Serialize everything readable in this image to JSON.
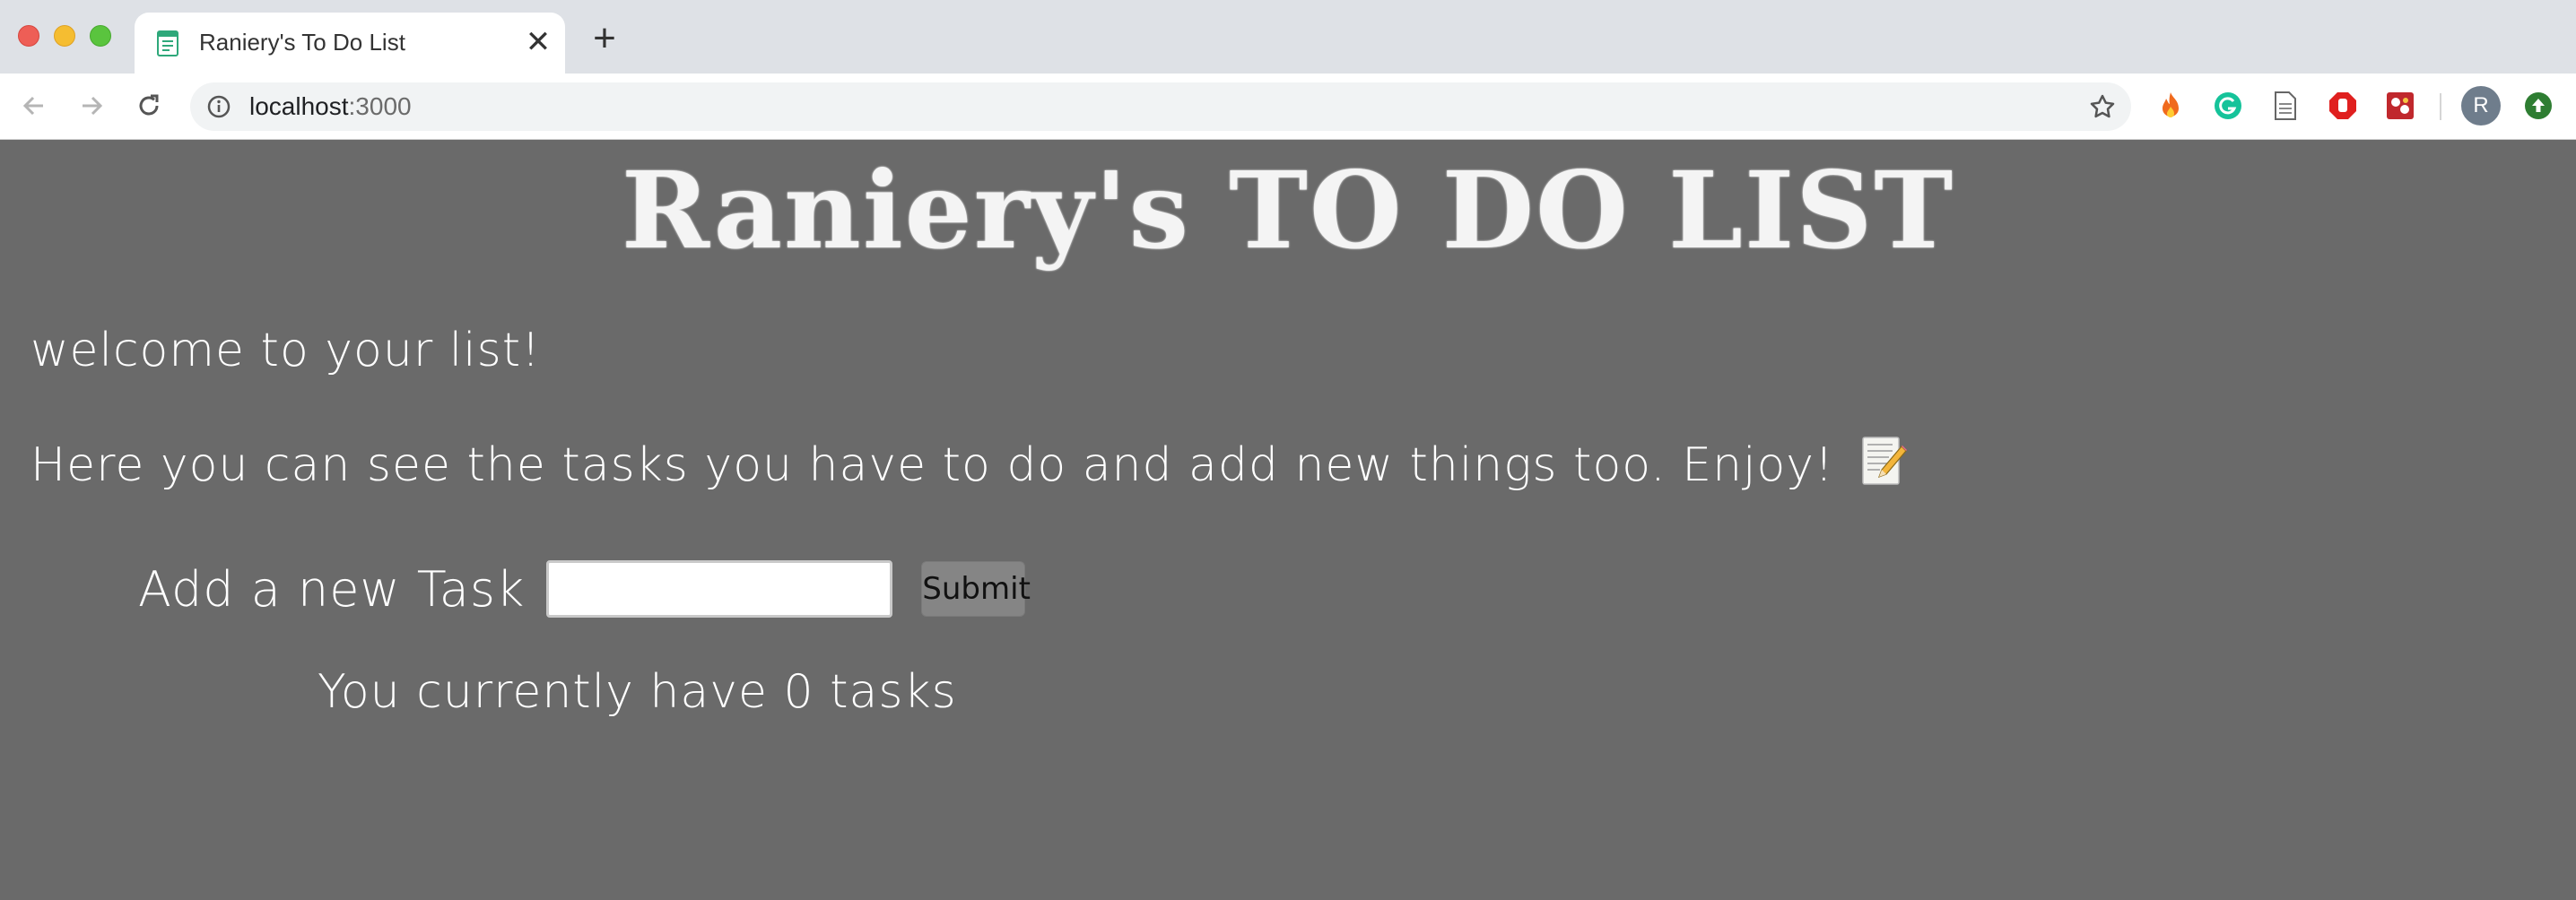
{
  "browser": {
    "tab": {
      "title": "Raniery's To Do List",
      "favicon": "notepad-icon",
      "close_glyph": "✕"
    },
    "new_tab_glyph": "+",
    "address": {
      "host": "localhost",
      "port": ":3000"
    },
    "avatar_initial": "R",
    "extensions": [
      "fire-icon",
      "grammarly-icon",
      "document-icon",
      "adblock-icon",
      "puzzle-icon",
      "update-icon"
    ]
  },
  "page": {
    "title": "Raniery's TO DO LIST",
    "welcome": "welcome to your list!",
    "intro": "Here you can see the tasks you have to do and add new things too. Enjoy!",
    "form": {
      "label": "Add a new Task",
      "input_value": "",
      "submit_label": "Submit"
    },
    "task_count_text": "You currently have 0 tasks"
  },
  "colors": {
    "page_background": "#6a6a6a",
    "text": "#ffffff",
    "submit_background": "#858585"
  }
}
